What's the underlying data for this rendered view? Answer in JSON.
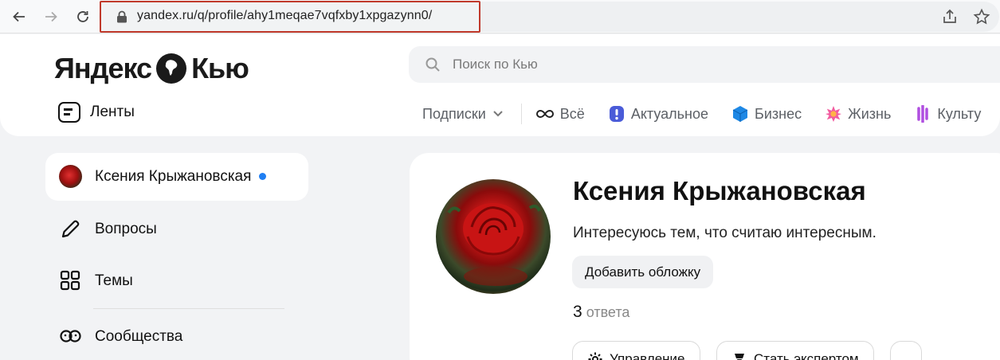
{
  "browser": {
    "url": "yandex.ru/q/profile/ahy1meqae7vqfxby1xpgazynn0/"
  },
  "header": {
    "logo_left": "Яндекс",
    "logo_right": "Кью",
    "search_placeholder": "Поиск по Кью",
    "feeds_label": "Ленты",
    "tabs": [
      {
        "label": "Подписки",
        "icon": "chevron-down-icon"
      },
      {
        "label": "Всё",
        "icon": "infinity-icon"
      },
      {
        "label": "Актуальное",
        "icon": "flame-icon"
      },
      {
        "label": "Бизнес",
        "icon": "cube-icon"
      },
      {
        "label": "Жизнь",
        "icon": "sparkle-icon"
      },
      {
        "label": "Культу",
        "icon": "wave-icon"
      }
    ]
  },
  "sidebar": {
    "profile_name": "Ксения Крыжановская",
    "items": [
      {
        "label": "Вопросы",
        "icon": "pencil-icon"
      },
      {
        "label": "Темы",
        "icon": "grid-icon"
      },
      {
        "label": "Сообщества",
        "icon": "community-icon"
      }
    ]
  },
  "profile": {
    "name": "Ксения Крыжановская",
    "bio": "Интересуюсь тем, что считаю интересным.",
    "add_cover_label": "Добавить обложку",
    "answers_count": "3",
    "answers_label": "ответа",
    "manage_label": "Управление",
    "become_expert_label": "Стать экспертом",
    "more_label": "..."
  },
  "colors": {
    "url_highlight": "#c0392b",
    "online_dot": "#1f7ef2",
    "page_bg": "#f2f3f5"
  }
}
